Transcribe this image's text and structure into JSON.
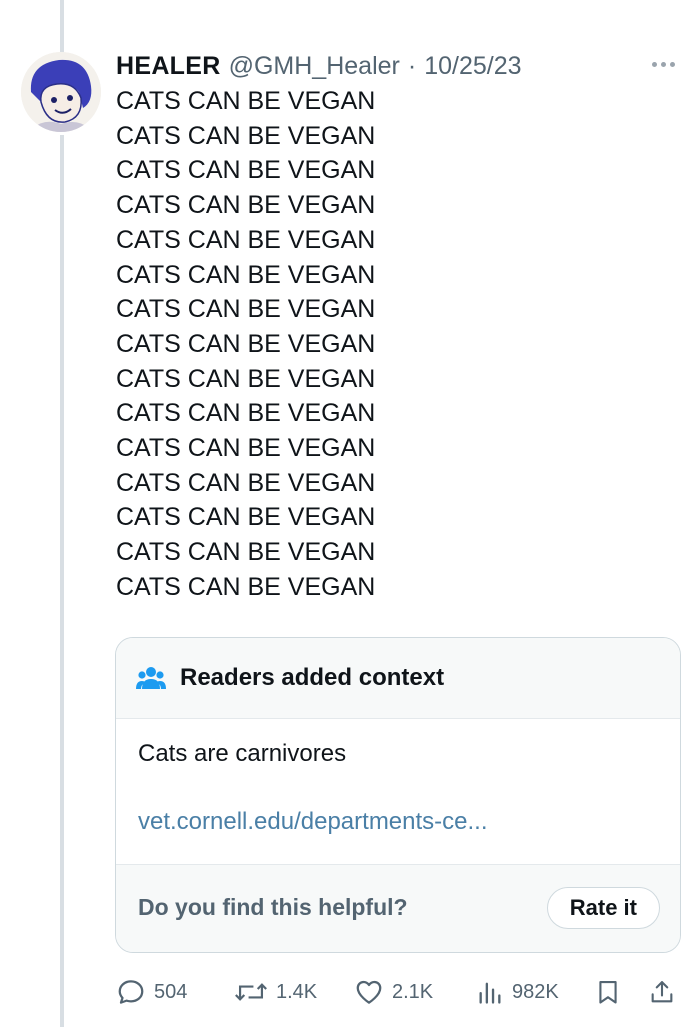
{
  "tweet": {
    "display_name": "HEALER",
    "handle": "@GMH_Healer",
    "separator": "·",
    "date": "10/25/23",
    "lines": [
      "CATS CAN BE VEGAN",
      "CATS CAN BE VEGAN",
      "CATS CAN BE VEGAN",
      "CATS CAN BE VEGAN",
      "CATS CAN BE VEGAN",
      "CATS CAN BE VEGAN",
      "CATS CAN BE VEGAN",
      "CATS CAN BE VEGAN",
      "CATS CAN BE VEGAN",
      "CATS CAN BE VEGAN",
      "CATS CAN BE VEGAN",
      "CATS CAN BE VEGAN",
      "CATS CAN BE VEGAN",
      "CATS CAN BE VEGAN",
      "CATS CAN BE VEGAN"
    ]
  },
  "note": {
    "icon": "people-icon",
    "title": "Readers added context",
    "text": "Cats are carnivores",
    "link": "vet.cornell.edu/departments-ce...",
    "question": "Do you find this helpful?",
    "rate_label": "Rate it"
  },
  "actions": {
    "replies": "504",
    "reposts": "1.4K",
    "likes": "2.1K",
    "views": "982K"
  },
  "colors": {
    "text": "#0f1419",
    "secondary": "#536471",
    "link": "#4a7fa6",
    "note_bg": "#f7f9f9",
    "border": "#cfd9de",
    "people_icon": "#1d9bf0"
  }
}
